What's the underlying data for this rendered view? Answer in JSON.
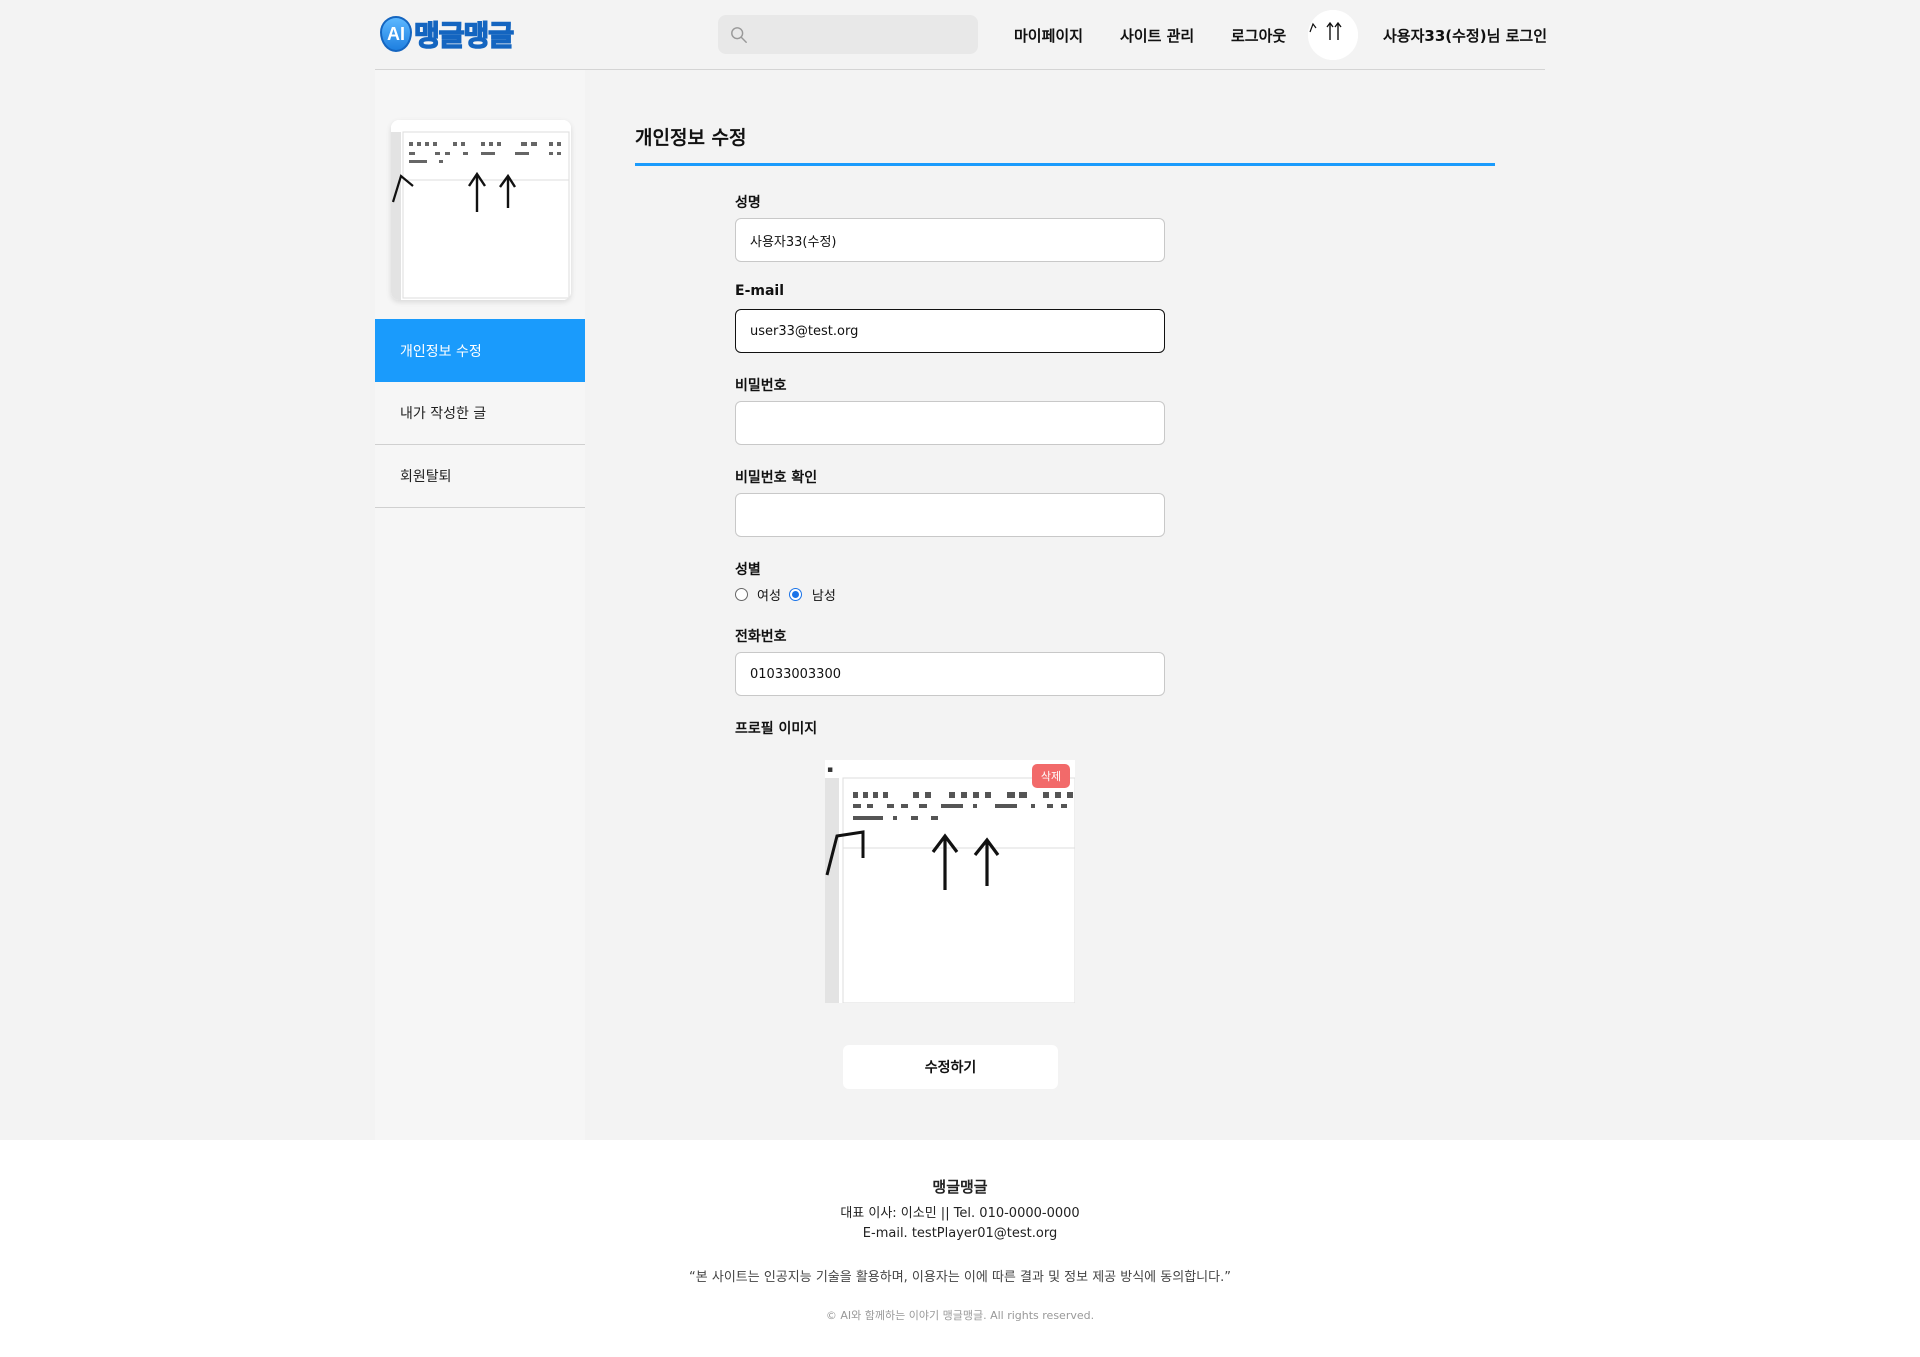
{
  "header": {
    "logo_ai": "AI",
    "logo_text": "맹글맹글",
    "search_placeholder": "",
    "nav": {
      "mypage": "마이페이지",
      "site_admin": "사이트 관리",
      "logout": "로그아웃",
      "user_greeting": "사용자33(수정)님 로그인"
    }
  },
  "sidebar": {
    "menu": [
      {
        "label": "개인정보 수정",
        "active": true
      },
      {
        "label": "내가 작성한 글",
        "active": false
      },
      {
        "label": "회원탈퇴",
        "active": false
      }
    ]
  },
  "form": {
    "title": "개인정보 수정",
    "name_label": "성명",
    "name_value": "사용자33(수정)",
    "email_label": "E-mail",
    "email_value": "user33@test.org",
    "password_label": "비밀번호",
    "password_value": "",
    "password_confirm_label": "비밀번호 확인",
    "password_confirm_value": "",
    "gender_label": "성별",
    "gender_female": "여성",
    "gender_male": "남성",
    "gender_selected": "male",
    "phone_label": "전화번호",
    "phone_value": "01033003300",
    "profile_label": "프로필 이미지",
    "delete_label": "삭제",
    "submit_label": "수정하기"
  },
  "footer": {
    "name": "맹글맹글",
    "ceo_line": "대표 이사: 이소민 || Tel. 010-0000-0000",
    "email_line": "E-mail. testPlayer01@test.org",
    "notice": "“본 사이트는 인공지능 기술을 활용하며, 이용자는 이에 따른 결과 및 정보 제공 방식에 동의합니다.”",
    "copyright": "© AI와 함께하는 이야기 맹글맹글. All rights reserved."
  },
  "colors": {
    "accent": "#1a9bfc",
    "delete": "#f26a6a",
    "background": "#f3f3f3"
  }
}
